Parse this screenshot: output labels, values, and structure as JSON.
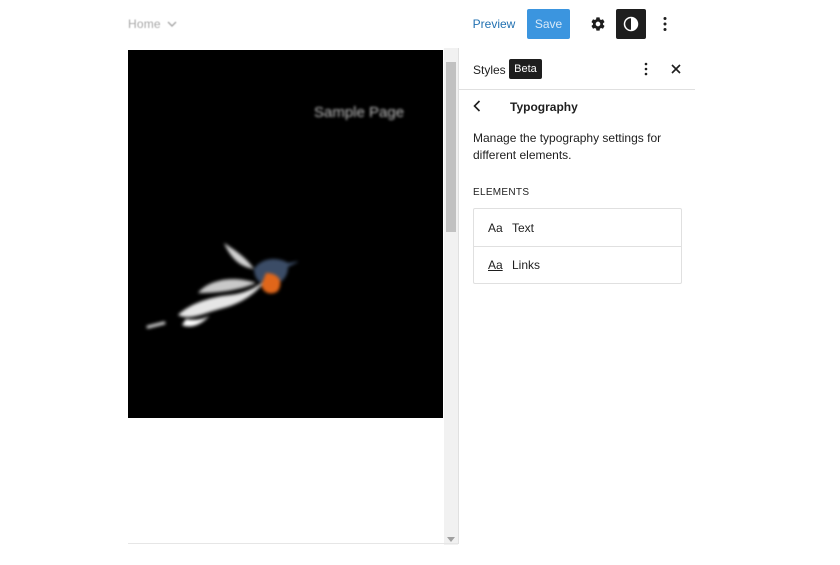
{
  "header": {
    "doc_title": "Home",
    "preview_label": "Preview",
    "save_label": "Save"
  },
  "canvas": {
    "nav_link": "Sample Page"
  },
  "sidebar": {
    "title": "Styles",
    "badge": "Beta",
    "panel_title": "Typography",
    "description": "Manage the typography settings for different elements.",
    "section_label": "ELEMENTS",
    "elements": [
      {
        "icon": "Aa",
        "label": "Text"
      },
      {
        "icon": "Aa",
        "label": "Links"
      }
    ]
  },
  "colors": {
    "accent": "#2271b1",
    "save_bg": "#0b7bd8",
    "dark": "#1e1e1e",
    "canvas_bg": "#000000"
  }
}
